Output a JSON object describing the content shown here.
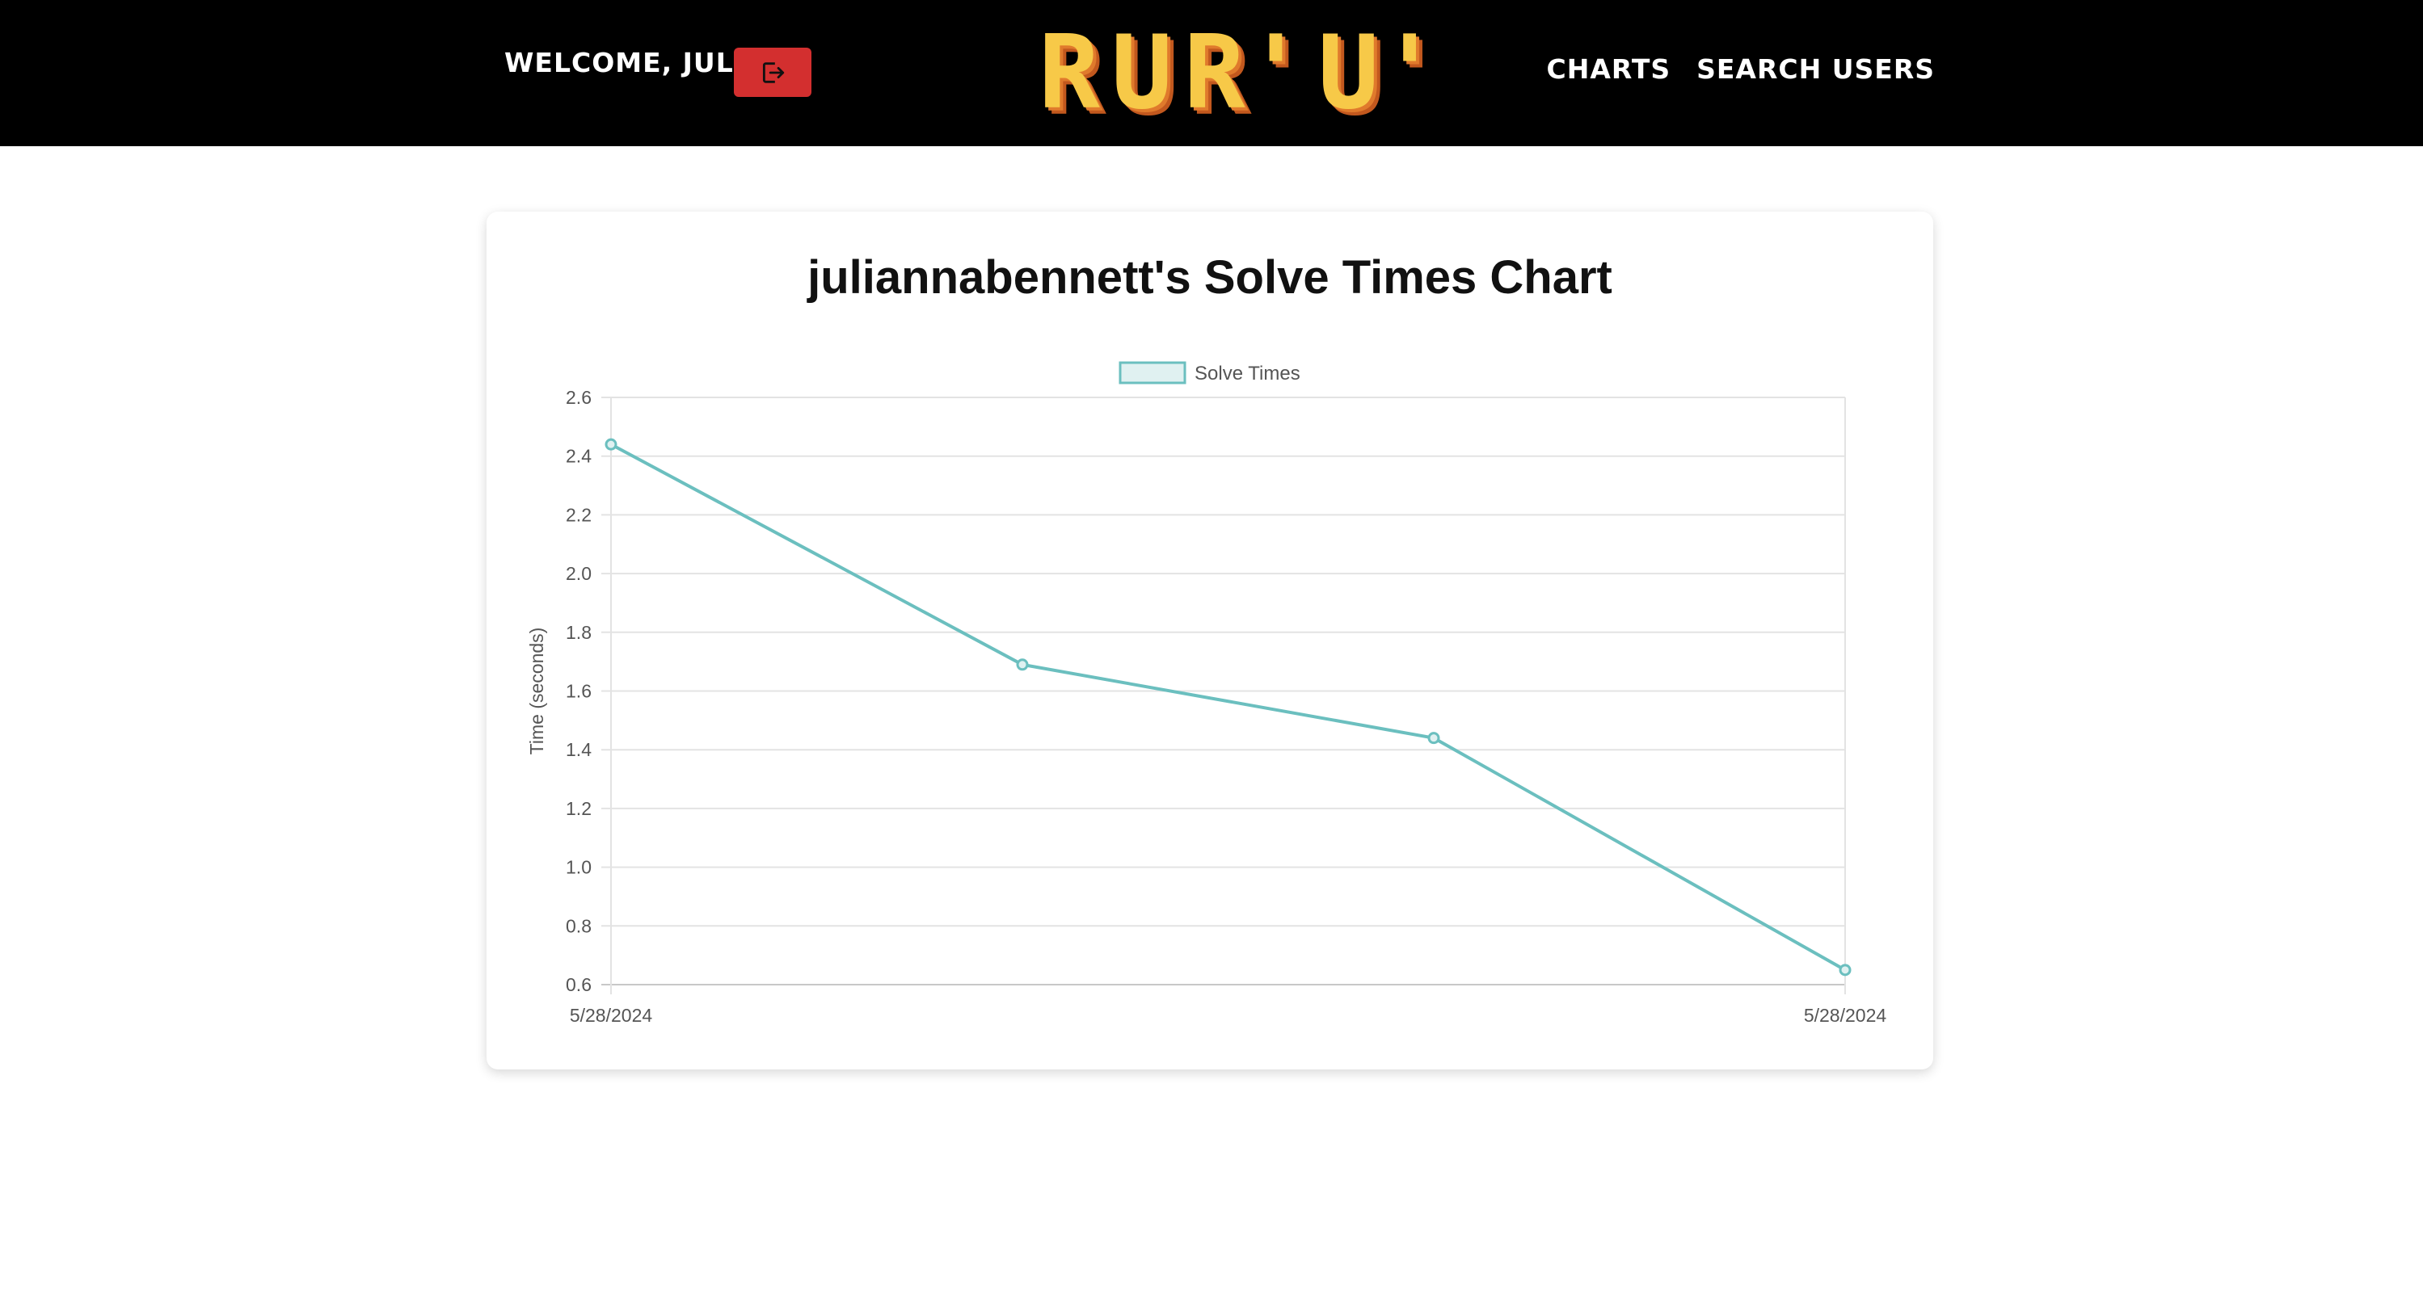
{
  "header": {
    "welcome_text": "WELCOME, JULI",
    "logo_chars": [
      "R",
      "U",
      "R'",
      "U'"
    ],
    "nav": [
      {
        "label": "CHARTS"
      },
      {
        "label": "SEARCH USERS"
      }
    ]
  },
  "colors": {
    "header_bg": "#000000",
    "logout_button": "#d32f2f",
    "series_line": "#6bbfbf",
    "series_fill": "#e0f1f1"
  },
  "icons": {
    "logout": "logout-icon"
  },
  "chart_data": {
    "type": "line",
    "title": "juliannabennett's Solve Times Chart",
    "ylabel": "Time (seconds)",
    "xlabel": "",
    "ylim": [
      0.6,
      2.6
    ],
    "yticks": [
      "0.6",
      "0.8",
      "1.0",
      "1.2",
      "1.4",
      "1.6",
      "1.8",
      "2.0",
      "2.2",
      "2.4",
      "2.6"
    ],
    "x_tick_labels": [
      "5/28/2024",
      "5/28/2024"
    ],
    "grid": true,
    "legend_position": "top",
    "series": [
      {
        "name": "Solve Times",
        "values": [
          2.44,
          1.69,
          1.44,
          0.65
        ]
      }
    ]
  }
}
